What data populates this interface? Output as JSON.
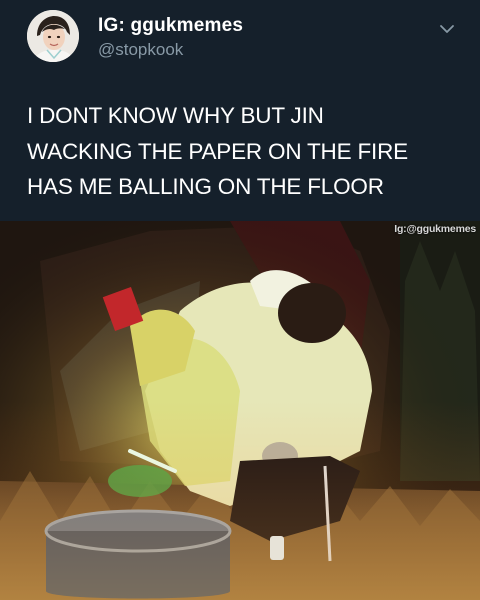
{
  "tweet": {
    "display_name": "IG: ggukmemes",
    "handle": "@stopkook",
    "text_lines": [
      "I DONT KNOW WHY BUT JIN",
      "WACKING THE PAPER ON THE FIRE",
      "HAS ME BALLING ON THE FLOOR"
    ]
  },
  "media": {
    "watermark": "Ig:@ggukmemes"
  },
  "icons": {
    "avatar": "profile-avatar",
    "more": "chevron-down-icon"
  },
  "colors": {
    "background": "#15202b",
    "handle": "#8899a6",
    "text": "#ffffff"
  }
}
